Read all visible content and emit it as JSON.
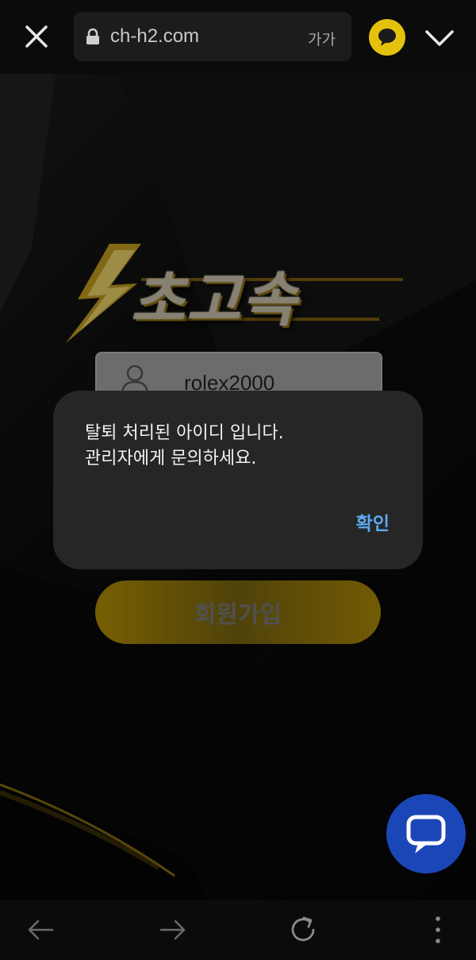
{
  "browser": {
    "url": "ch-h2.com",
    "text_size_label": "가가",
    "icons": {
      "close": "close-icon",
      "lock": "lock-icon",
      "kakao": "chat-bubble-icon",
      "menu": "chevron-down-icon"
    }
  },
  "page": {
    "logo_text": "초고속",
    "id_field_value": "rolex2000",
    "join_button_label": "회원가입",
    "accent_color": "#d4a90c",
    "chat_fab_color": "#1a46b8"
  },
  "dialog": {
    "message": "탈퇴 처리된 아이디 입니다.\n관리자에게 문의하세요.",
    "ok_label": "확인"
  },
  "bottom_nav": {
    "icons": [
      "back-arrow-icon",
      "forward-arrow-icon",
      "reload-icon",
      "more-vert-icon"
    ]
  }
}
